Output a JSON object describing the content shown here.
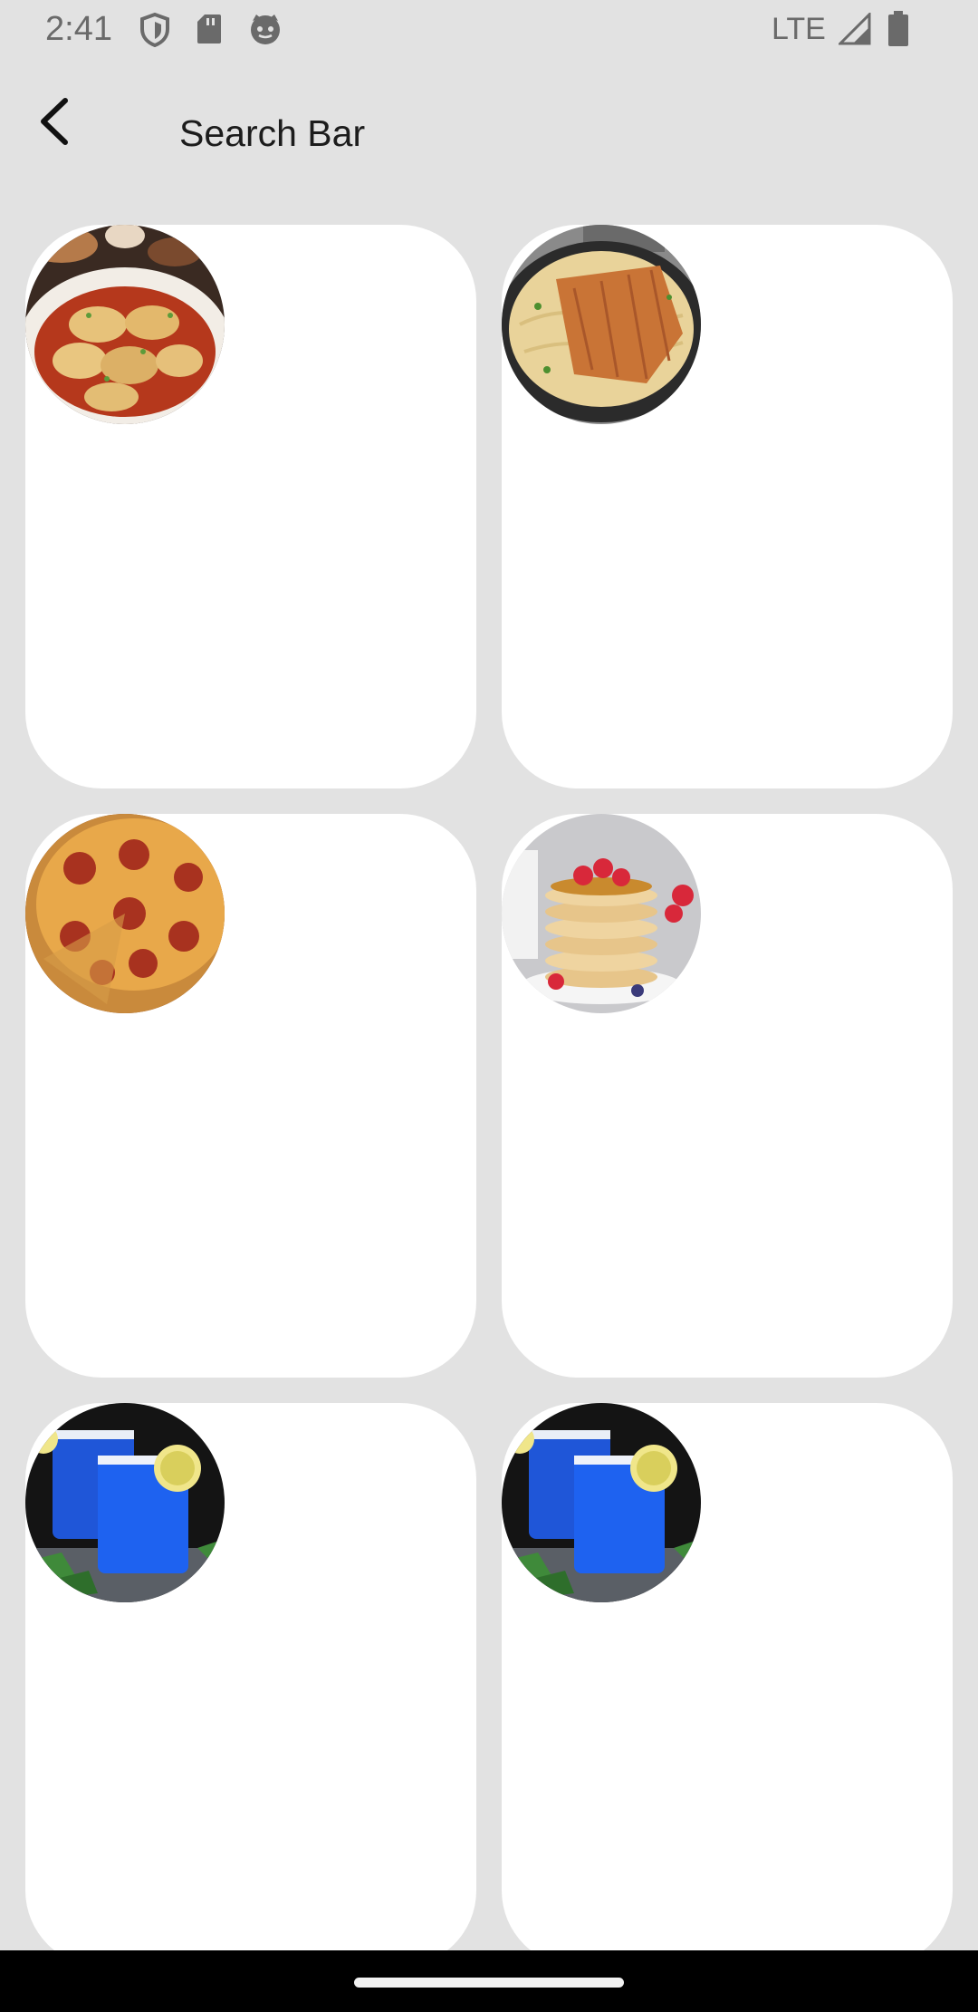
{
  "status_bar": {
    "time": "2:41",
    "network": "LTE",
    "left_icons": [
      "shield-icon",
      "sd-card-icon",
      "cat-face-icon"
    ],
    "right_icons": [
      "signal-icon",
      "battery-icon"
    ]
  },
  "app_bar": {
    "title": "Search Bar",
    "back_icon": "chevron-left-icon"
  },
  "grid": {
    "items": [
      {
        "image": "dumplings-in-chili-oil"
      },
      {
        "image": "cutlet-over-pasta-skillet"
      },
      {
        "image": "pepperoni-pizza"
      },
      {
        "image": "pancake-stack-with-berries"
      },
      {
        "image": "blue-lagoon-drinks"
      },
      {
        "image": "blue-lagoon-drinks"
      }
    ]
  },
  "colors": {
    "background": "#e2e2e2",
    "card": "#ffffff",
    "nav_bar": "#000000"
  }
}
